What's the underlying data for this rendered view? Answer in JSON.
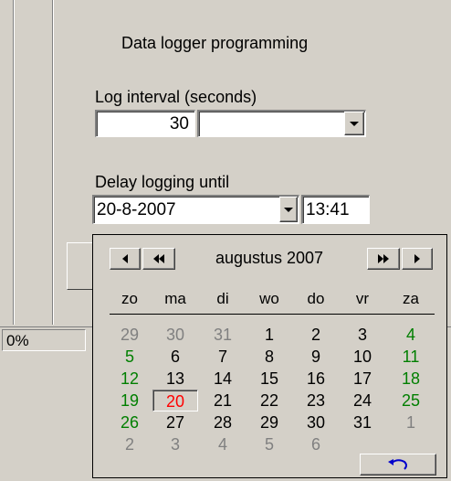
{
  "form": {
    "group_title": "Data logger programming",
    "log_interval_label": "Log interval (seconds)",
    "log_interval_value": "30",
    "log_interval_unit_value": "",
    "delay_label": "Delay logging until",
    "delay_date": "20-8-2007",
    "delay_time": "13:41"
  },
  "status": {
    "progress_text": "0%"
  },
  "calendar": {
    "month_title": "augustus 2007",
    "day_headers": [
      "zo",
      "ma",
      "di",
      "wo",
      "do",
      "vr",
      "za"
    ],
    "weeks": [
      [
        "29",
        "30",
        "31",
        "1",
        "2",
        "3",
        "4"
      ],
      [
        "5",
        "6",
        "7",
        "8",
        "9",
        "10",
        "11"
      ],
      [
        "12",
        "13",
        "14",
        "15",
        "16",
        "17",
        "18"
      ],
      [
        "19",
        "20",
        "21",
        "22",
        "23",
        "24",
        "25"
      ],
      [
        "26",
        "27",
        "28",
        "29",
        "30",
        "31",
        "1"
      ],
      [
        "2",
        "3",
        "4",
        "5",
        "6",
        "",
        ""
      ]
    ],
    "selected_day": "20",
    "colors": {
      "weekend": "#007f00",
      "other_month": "#808080",
      "selected": "#ff0000",
      "arrow_blue": "#0000cc"
    }
  }
}
